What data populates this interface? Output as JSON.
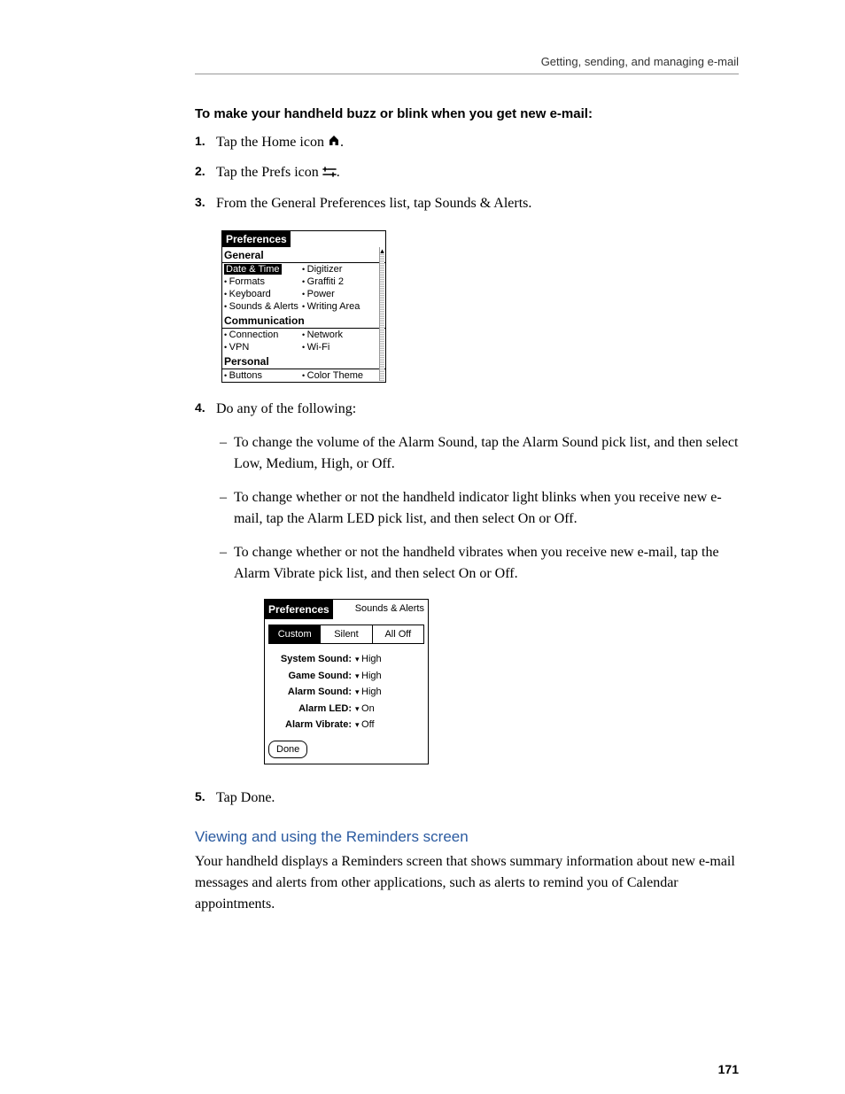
{
  "header": {
    "running": "Getting, sending, and managing e-mail"
  },
  "task": {
    "title": "To make your handheld buzz or blink when you get new e-mail:"
  },
  "steps": [
    {
      "num": "1.",
      "text_pre": "Tap the Home icon ",
      "text_post": "."
    },
    {
      "num": "2.",
      "text_pre": "Tap the Prefs icon ",
      "text_post": "."
    },
    {
      "num": "3.",
      "text": "From the General Preferences list, tap Sounds & Alerts."
    },
    {
      "num": "4.",
      "text": "Do any of the following:"
    },
    {
      "num": "5.",
      "text": "Tap Done."
    }
  ],
  "sub4": [
    "To change the volume of the Alarm Sound, tap the Alarm Sound pick list, and then select Low, Medium, High, or Off.",
    "To change whether or not the handheld indicator light blinks when you receive new e-mail, tap the Alarm LED pick list, and then select On or Off.",
    "To change whether or not the handheld vibrates when you receive new e-mail, tap the Alarm Vibrate pick list, and then select On or Off."
  ],
  "palm1": {
    "title": "Preferences",
    "sections": {
      "general": {
        "heading": "General",
        "rows": [
          [
            "Date & Time",
            "Digitizer"
          ],
          [
            "Formats",
            "Graffiti 2"
          ],
          [
            "Keyboard",
            "Power"
          ],
          [
            "Sounds & Alerts",
            "Writing Area"
          ]
        ]
      },
      "communication": {
        "heading": "Communication",
        "rows": [
          [
            "Connection",
            "Network"
          ],
          [
            "VPN",
            "Wi-Fi"
          ]
        ]
      },
      "personal": {
        "heading": "Personal",
        "rows": [
          [
            "Buttons",
            "Color Theme"
          ]
        ]
      }
    }
  },
  "palm2": {
    "title": "Preferences",
    "subtitle": "Sounds & Alerts",
    "tabs": [
      "Custom",
      "Silent",
      "All Off"
    ],
    "settings": [
      {
        "label": "System Sound:",
        "value": "High"
      },
      {
        "label": "Game Sound:",
        "value": "High"
      },
      {
        "label": "Alarm Sound:",
        "value": "High"
      },
      {
        "label": "Alarm LED:",
        "value": "On"
      },
      {
        "label": "Alarm Vibrate:",
        "value": "Off"
      }
    ],
    "done": "Done"
  },
  "section2": {
    "heading": "Viewing and using the Reminders screen",
    "para": "Your handheld displays a Reminders screen that shows summary information about new e-mail messages and alerts from other applications, such as alerts to remind you of Calendar appointments."
  },
  "page_number": "171"
}
